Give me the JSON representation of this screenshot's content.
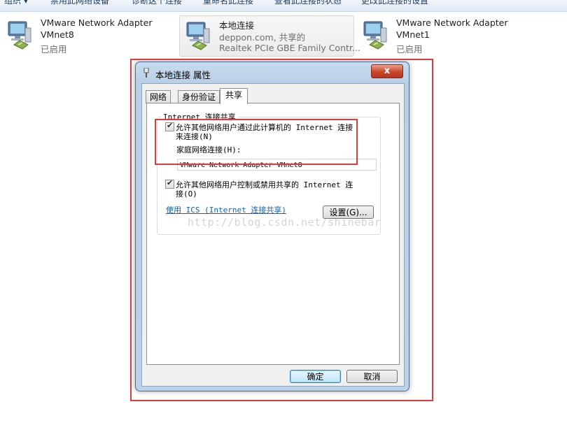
{
  "toolbar": {
    "items": [
      "组织 ▾",
      "禁用此网络设备",
      "诊断这个连接",
      "重命名此连接",
      "查看此连接的状态",
      "更改此连接的设置"
    ]
  },
  "adapters": [
    {
      "name": "VMware Network Adapter",
      "line2": "VMnet8",
      "line3": "已启用",
      "icon": "network-adapter-icon"
    },
    {
      "name": "本地连接",
      "line2": "deppon.com, 共享的",
      "line3": "Realtek PCIe GBE Family Contr...",
      "icon": "network-adapter-icon"
    },
    {
      "name": "VMware Network Adapter",
      "line2": "VMnet1",
      "line3": "已启用",
      "icon": "network-adapter-icon"
    }
  ],
  "dialog": {
    "title": "本地连接 属性",
    "close_label": "x",
    "tabs": [
      "网络",
      "身份验证",
      "共享"
    ],
    "group_label": "Internet 连接共享",
    "allow_share_line1": "允许其他网络用户通过此计算机的 Internet 连接",
    "allow_share_line2": "来连接(N)",
    "home_network_label": "家庭网络连接(H):",
    "home_network_value": "VMware Network Adapter VMnet8",
    "allow_control_line1": "允许其他网络用户控制或禁用共享的 Internet 连",
    "allow_control_line2": "接(O)",
    "ics_link": "使用 ICS (Internet 连接共享)",
    "settings_button": "设置(G)...",
    "ok_button": "确定",
    "cancel_button": "取消"
  },
  "watermark": "http://blog.csdn.net/shinebar",
  "colors": {
    "highlight": "#e53a3a",
    "link": "#0b64c0"
  }
}
